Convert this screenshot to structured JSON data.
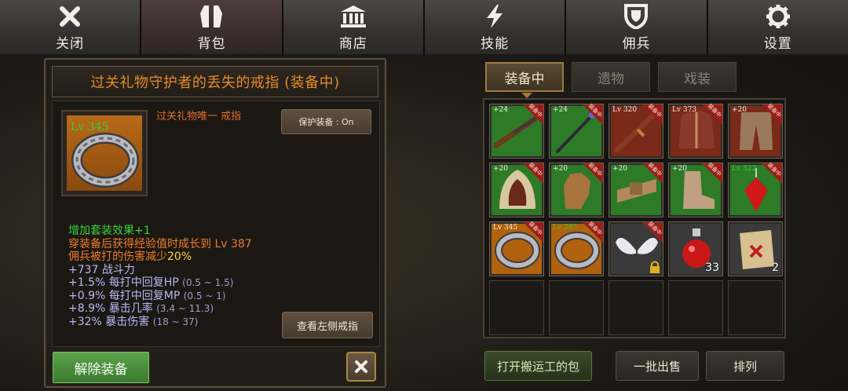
{
  "nav": {
    "tabs": [
      {
        "label": "关闭",
        "icon": "close-x-icon"
      },
      {
        "label": "背包",
        "icon": "backpack-icon"
      },
      {
        "label": "商店",
        "icon": "shop-icon"
      },
      {
        "label": "技能",
        "icon": "skill-bolt-icon"
      },
      {
        "label": "佣兵",
        "icon": "mercenary-shield-icon"
      },
      {
        "label": "设置",
        "icon": "gear-icon"
      }
    ],
    "active_index": 1
  },
  "item": {
    "title": "过关礼物守护者的丢失的戒指 (装备中)",
    "level": "Lv 345",
    "subtitle": "过关礼物唯一 戒指",
    "protect_label": "保护装备 : On",
    "stats": {
      "set_effect": "增加套装效果+1",
      "exp_growth": "穿装备后获得经验值时成长到 Lv 387",
      "merc_damage_prefix": "佣兵被打的伤害减少",
      "merc_damage_value": "20%",
      "power": "+737 战斗力",
      "hp_regen": "+1.5% 每打中回复HP",
      "hp_regen_range": "(0.5 ~ 1.5)",
      "mp_regen": "+0.9% 每打中回复MP",
      "mp_regen_range": "(0.5 ~ 1)",
      "crit_rate": "+8.9% 暴击几率",
      "crit_rate_range": "(3.4 ~ 11.3)",
      "crit_damage": "+32% 暴击伤害",
      "crit_damage_range": "(18 ~ 37)"
    },
    "view_left_ring_label": "查看左侧戒指",
    "unequip_label": "解除装备"
  },
  "inventory": {
    "tabs": [
      "装备中",
      "遗物",
      "戏装"
    ],
    "active_tab": 0,
    "equipped_tag": "装备中",
    "slots": [
      {
        "label": "+24",
        "icon": "musket-icon",
        "bg": "#2d7a27",
        "equipped": true
      },
      {
        "label": "+24",
        "icon": "staff-icon",
        "bg": "#2d7a27",
        "equipped": true
      },
      {
        "label": "Lv 320",
        "icon": "rifle-icon",
        "bg": "#7a2a18",
        "equipped": true
      },
      {
        "label": "Lv 373",
        "icon": "coat-icon",
        "bg": "#7a2a18",
        "equipped": true
      },
      {
        "label": "+20",
        "icon": "pants-icon",
        "bg": "#7a2a18",
        "equipped": true
      },
      {
        "label": "+20",
        "icon": "hood-icon",
        "bg": "#2d7a27",
        "equipped": true
      },
      {
        "label": "+20",
        "icon": "glove-icon",
        "bg": "#2d7a27",
        "equipped": true
      },
      {
        "label": "+20",
        "icon": "belt-icon",
        "bg": "#2d7a27",
        "equipped": true
      },
      {
        "label": "+20",
        "icon": "boots-icon",
        "bg": "#2d7a27",
        "equipped": true
      },
      {
        "label": "Lv 322",
        "icon": "ruby-pendant-icon",
        "bg": "#2d7a27",
        "equipped": true,
        "green": true
      },
      {
        "label": "Lv 345",
        "icon": "ring-icon",
        "bg": "#b0620f",
        "equipped": true
      },
      {
        "label": "Lv 345",
        "icon": "ring-icon",
        "bg": "#b0620f",
        "equipped": true,
        "green": true
      },
      {
        "label": "",
        "icon": "wings-icon",
        "bg": "#3a3a3a",
        "equipped": true,
        "locked": true
      },
      {
        "label": "",
        "icon": "potion-icon",
        "bg": "#3a3a3a",
        "equipped": false,
        "qty": "33"
      },
      {
        "label": "",
        "icon": "scroll-icon",
        "bg": "#3a3a3a",
        "equipped": false,
        "qty": "2"
      }
    ]
  },
  "actions": {
    "open_porter_bag": "打开搬运工的包",
    "bulk_sell": "一批出售",
    "sort": "排列"
  }
}
